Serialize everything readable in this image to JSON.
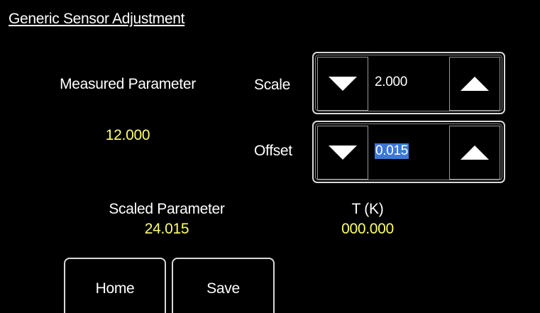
{
  "title": "Generic Sensor Adjustment",
  "measured": {
    "label": "Measured Parameter",
    "value": "12.000"
  },
  "scale": {
    "label": "Scale",
    "value": "2.000"
  },
  "offset": {
    "label": "Offset",
    "value": "0.015"
  },
  "scaled": {
    "label": "Scaled Parameter",
    "value": "24.015"
  },
  "temperature": {
    "label": "T (K)",
    "value": "000.000"
  },
  "buttons": {
    "home": "Home",
    "save": "Save"
  },
  "colors": {
    "background": "#000000",
    "label": "#ffffff",
    "value": "#ffff66",
    "selection": "#3a78d8"
  },
  "icons": {
    "decrement": "triangle-down-icon",
    "increment": "triangle-up-icon"
  }
}
